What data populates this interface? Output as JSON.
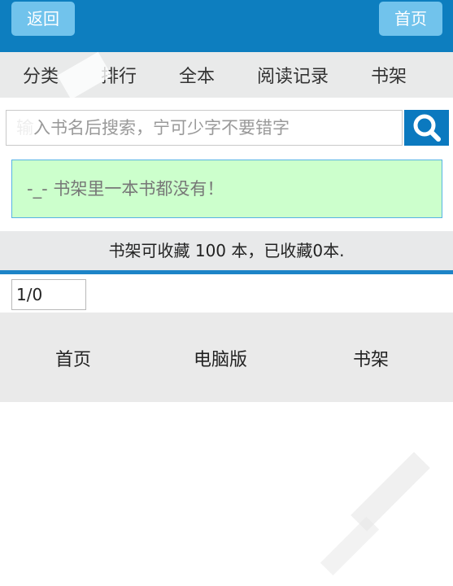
{
  "header": {
    "back_label": "返回",
    "home_label": "首页"
  },
  "nav": {
    "items": [
      "分类",
      "排行",
      "全本",
      "阅读记录",
      "书架"
    ]
  },
  "search": {
    "placeholder": "输入书名后搜索，宁可少字不要错字",
    "value": ""
  },
  "notice": {
    "text": "-_- 书架里一本书都没有！"
  },
  "capacity": {
    "text": "书架可收藏 100 本，已收藏0本."
  },
  "pagination": {
    "value": "1/0"
  },
  "footer": {
    "home": "首页",
    "pc": "电脑版",
    "shelf": "书架"
  },
  "colors": {
    "header_bg": "#0d7ebf",
    "button_bg": "#71c3ec",
    "notice_bg": "#ccffcc",
    "accent": "#1d84c7"
  }
}
